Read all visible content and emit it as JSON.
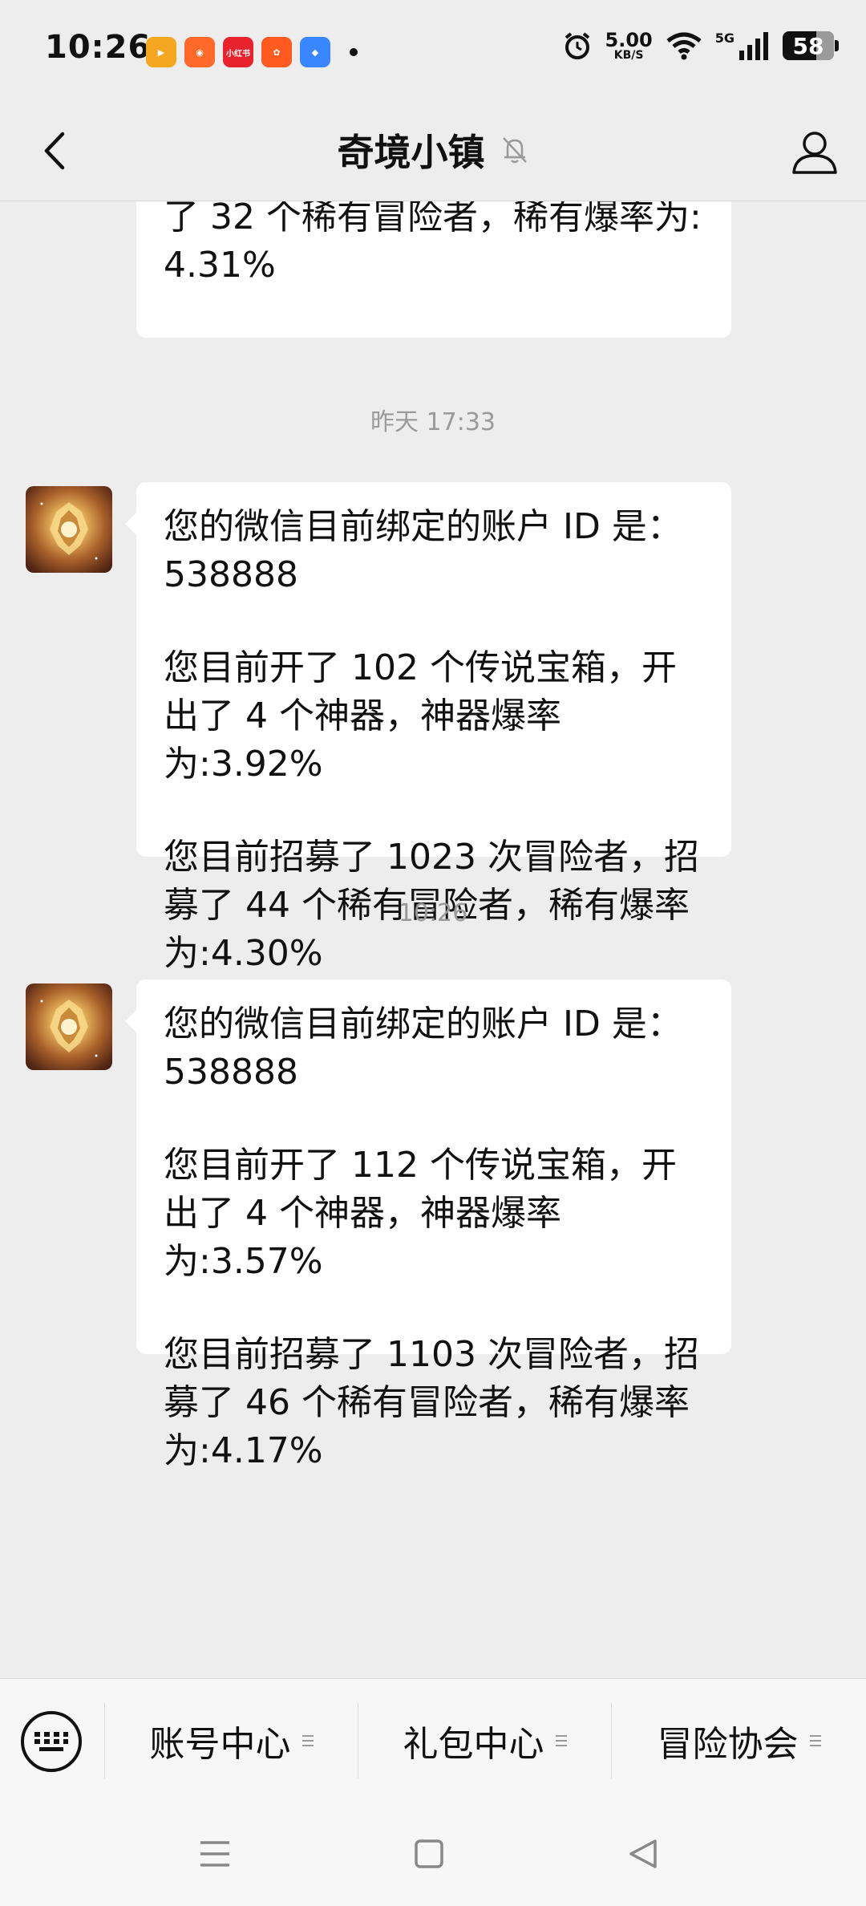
{
  "status_bar": {
    "time": "10:26",
    "app_icons": [
      {
        "name": "video-app-icon",
        "color": "#f5a623",
        "label": ""
      },
      {
        "name": "shopping-app-icon",
        "color": "#ff6a2a",
        "label": ""
      },
      {
        "name": "xiaohongshu-icon",
        "color": "#e8232e",
        "label": "小红书"
      },
      {
        "name": "kuaishou-icon",
        "color": "#ff5a1f",
        "label": ""
      },
      {
        "name": "blue-app-icon",
        "color": "#3a86ff",
        "label": ""
      }
    ],
    "net_speed": "5.00",
    "net_unit": "KB/S",
    "network_type": "5G",
    "battery": "58"
  },
  "header": {
    "title": "奇境小镇"
  },
  "messages": {
    "partial_text": "了 32 个稀有冒险者，稀有爆率为:\n4.31%",
    "group1": {
      "timestamp": "昨天 17:33",
      "p1": "您的微信目前绑定的账户 ID 是：538888",
      "p2": "您目前开了 102 个传说宝箱，开出了 4 个神器，神器爆率为:3.92%",
      "p3": "您目前招募了 1023 次冒险者，招募了 44 个稀有冒险者，稀有爆率为:4.30%"
    },
    "group2": {
      "timestamp": "10:26",
      "p1": "您的微信目前绑定的账户 ID 是：538888",
      "p2": "您目前开了 112 个传说宝箱，开出了 4 个神器，神器爆率为:3.57%",
      "p3": "您目前招募了 1103 次冒险者，招募了 46 个稀有冒险者，稀有爆率为:4.17%"
    }
  },
  "menu": {
    "item1": "账号中心",
    "item2": "礼包中心",
    "item3": "冒险协会"
  },
  "colors": {
    "background": "#ededed",
    "bubble": "#ffffff",
    "timestamp": "#9a9a9a"
  }
}
